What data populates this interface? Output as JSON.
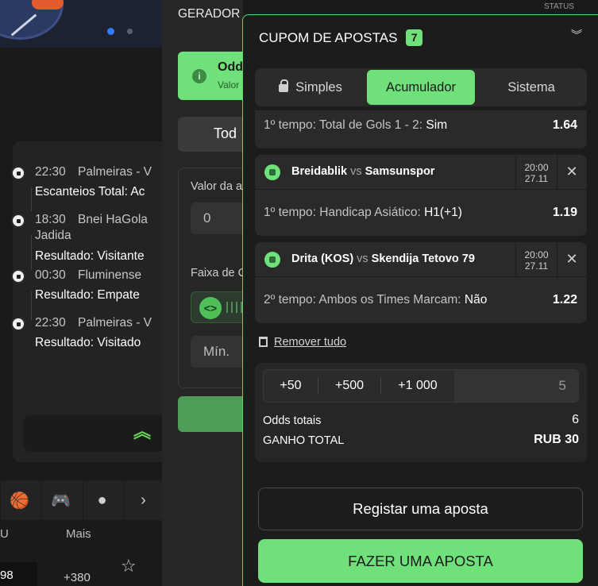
{
  "generator": {
    "title": "GERADOR DE APOSTAS",
    "alert_title": "Odd",
    "alert_sub": "Valor",
    "tab_all": "Tod",
    "amount_label": "Valor da a",
    "amount_value": "0",
    "range_label": "Faixa de C",
    "min_placeholder": "Mín."
  },
  "status_label": "STATUS",
  "my_bets": [
    {
      "time": "22:30",
      "teams": "Palmeiras - V",
      "teams2": "",
      "result": "Escanteios Total: Ac"
    },
    {
      "time": "18:30",
      "teams": "Bnei HaGola",
      "teams2": "Jadida",
      "result": "Resultado: Visitante"
    },
    {
      "time": "00:30",
      "teams": "Fluminense",
      "teams2": "",
      "result": "Resultado: Empate"
    },
    {
      "time": "22:30",
      "teams": "Palmeiras - V",
      "teams2": "",
      "result": "Resultado: Visitado"
    }
  ],
  "sports_icons": [
    "basketball-icon",
    "gamepad-icon",
    "hockey-puck-icon",
    "chevron-right-icon"
  ],
  "table": {
    "col_u": "U",
    "col_mais": "Mais",
    "odd_value": "98",
    "more_odds": "+380"
  },
  "coupon": {
    "title": "CUPOM DE APOSTAS",
    "count": "7",
    "tabs": [
      "Simples",
      "Acumulador",
      "Sistema"
    ],
    "active_tab": "Acumulador",
    "first_selection": {
      "market": "1º tempo: Total de Gols 1 - 2: ",
      "pick": "Sim",
      "odd": "1.64"
    },
    "selections": [
      {
        "home": "Breidablik",
        "vs": "vs",
        "away": "Samsunspor",
        "time": "20:00",
        "date": "27.11",
        "market": "1º tempo: Handicap Asiático: ",
        "pick": "H1(+1)",
        "odd": "1.19"
      },
      {
        "home": "Drita (KOS)",
        "vs": "vs",
        "away": "Skendija Tetovo 79",
        "time": "20:00",
        "date": "27.11",
        "market": "2º tempo: Ambos os Times Marcam: ",
        "pick": "Não",
        "odd": "1.22"
      }
    ],
    "remove_all": "Remover tudo",
    "quick_stakes": [
      "+50",
      "+500",
      "+1 000"
    ],
    "stake_value": "5",
    "total_odds_label": "Odds totais",
    "total_odds_value": "6",
    "total_win_label": "GANHO TOTAL",
    "total_win_value": "RUB 30",
    "register_label": "Registar uma aposta",
    "place_label": "FAZER UMA APOSTA"
  },
  "colors": {
    "accent": "#6fe07a",
    "background": "#1a1a1a",
    "card": "#2a2a2a"
  }
}
